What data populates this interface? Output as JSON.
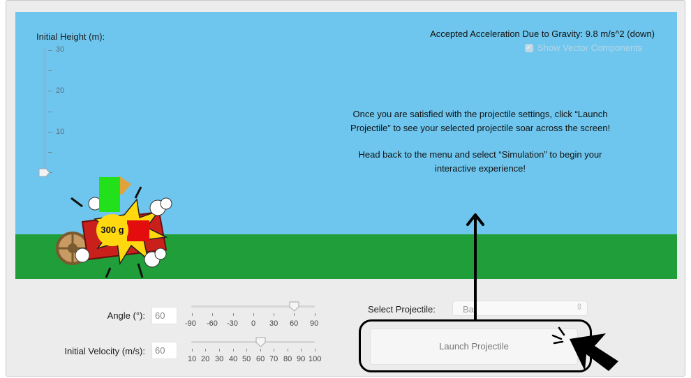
{
  "height_slider": {
    "label": "Initial Height (m):",
    "ticks": [
      "30",
      "20",
      "10"
    ],
    "value_m": 0
  },
  "gravity_text": "Accepted Acceleration Due to Gravity: 9.8 m/s^2 (down)",
  "vector_components": {
    "label": "Show Vector Components",
    "checked": true
  },
  "instructions": {
    "line1": "Once you are satisfied with the projectile settings, click “Launch Projectile” to see your selected projectile soar across the screen!",
    "line2": "Head back to the menu and select “Simulation” to begin your interactive experience!"
  },
  "projectile_mass": "300 g",
  "angle": {
    "label": "Angle (°):",
    "value": "60",
    "ticks": [
      "-90",
      "-60",
      "-30",
      "0",
      "30",
      "60",
      "90"
    ]
  },
  "velocity": {
    "label": "Initial Velocity (m/s):",
    "value": "60",
    "ticks": [
      "10",
      "20",
      "30",
      "40",
      "50",
      "60",
      "70",
      "80",
      "90",
      "100"
    ]
  },
  "select_projectile": {
    "label": "Select Projectile:",
    "selected": "Bal"
  },
  "launch_button": {
    "label": "Launch Projectile"
  },
  "colors": {
    "sky": "#6ec6ee",
    "ground": "#1f9e3a",
    "mass": "#ffd80f"
  },
  "icons": [
    "checkbox-icon",
    "chevron-updown-icon",
    "cursor-arrow-icon",
    "up-arrow-icon"
  ]
}
